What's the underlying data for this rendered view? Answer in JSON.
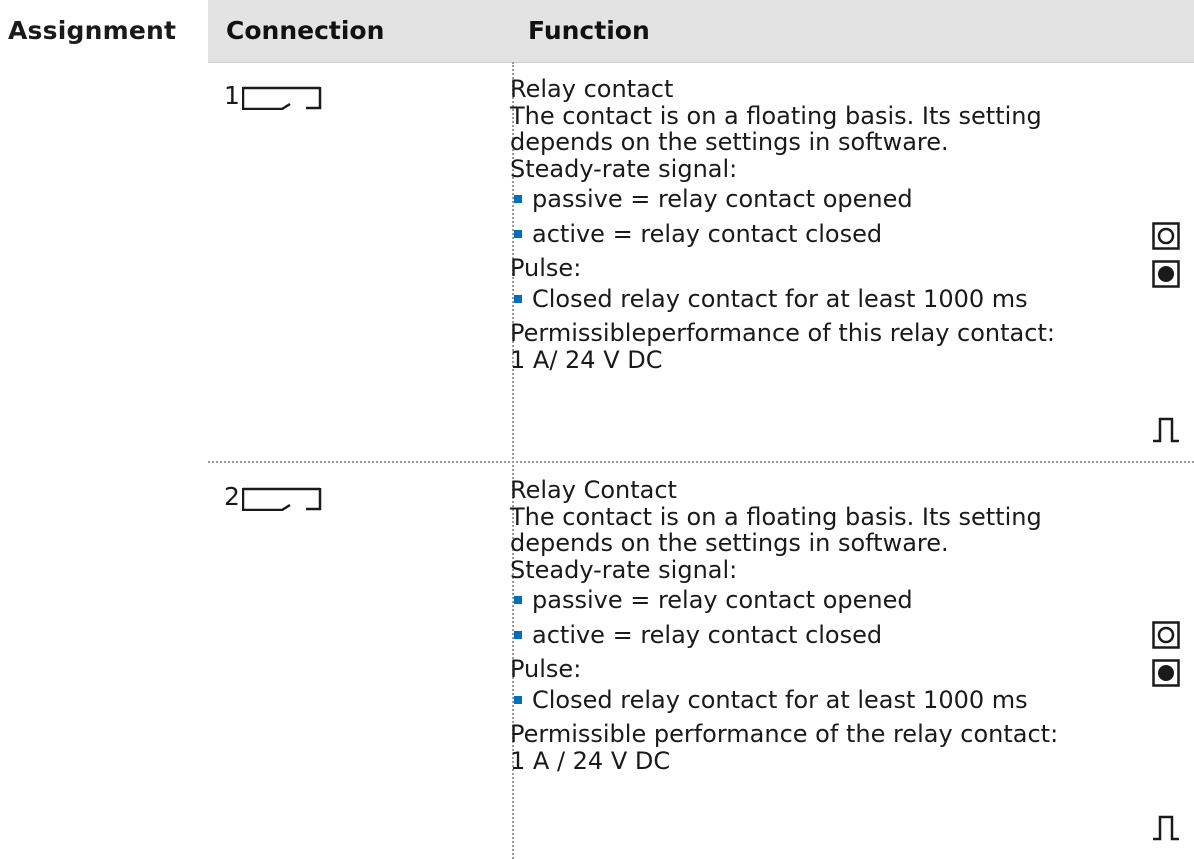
{
  "section_label": "Assignment",
  "table": {
    "headers": {
      "connection": "Connection",
      "function": "Function"
    },
    "rows": [
      {
        "connection_number": "1",
        "connection_icon": "relay-contact-symbol",
        "title": "Relay contact",
        "description_lines": [
          "The contact is on a floating basis. Its setting",
          "depends on the settings in software."
        ],
        "steady_label": "Steady-rate signal:",
        "steady_items": [
          "passive = relay contact opened",
          "active = relay contact closed"
        ],
        "pulse_label": "Pulse:",
        "pulse_items": [
          "Closed relay contact for at least 1000 ms"
        ],
        "performance_label": "Permissibleperformance of this relay contact:",
        "performance_value": "1 A/ 24 V DC",
        "icons": [
          "passive-open-icon",
          "active-closed-icon",
          "pulse-icon"
        ]
      },
      {
        "connection_number": "2",
        "connection_icon": "relay-contact-symbol",
        "title": "Relay Contact",
        "description_lines": [
          "The contact is on a floating basis. Its setting",
          "depends on the settings in software."
        ],
        "steady_label": "Steady-rate signal:",
        "steady_items": [
          "passive = relay contact opened",
          "active = relay contact closed"
        ],
        "pulse_label": "Pulse:",
        "pulse_items": [
          "Closed relay contact for at least 1000 ms"
        ],
        "performance_label": "Permissible performance of the relay contact:",
        "performance_value": "1 A / 24 V DC",
        "icons": [
          "passive-open-icon",
          "active-closed-icon",
          "pulse-icon"
        ]
      }
    ]
  },
  "colors": {
    "header_background": "#e3e3e3",
    "bullet": "#0070c0",
    "divider": "#9a9a9a",
    "text": "#1a1a1a"
  }
}
